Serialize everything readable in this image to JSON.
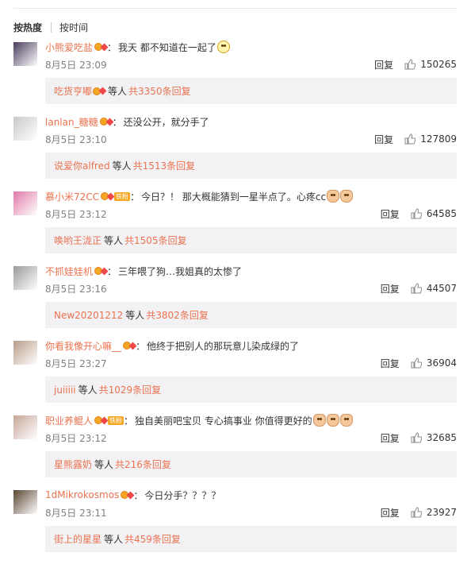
{
  "sort": {
    "hot": "按热度",
    "time": "按时间"
  },
  "comments": [
    {
      "user": "小熊爱吃盐",
      "text": "我天 都不知道在一起了",
      "emoji": [
        "wow"
      ],
      "time": "8月5日 23:09",
      "likes": "150265",
      "reply_label": "回复",
      "sub_user": "吃货亨嘟",
      "sub_mid": "等人",
      "sub_total": "共3350条回复",
      "fan_badge": false,
      "sub_badge": true,
      "avatar_color": "#4a3d5c"
    },
    {
      "user": "lanlan_糖糖",
      "text": "还没公开，就分手了",
      "emoji": [],
      "time": "8月5日 23:10",
      "likes": "127809",
      "reply_label": "回复",
      "sub_user": "说爱你alfred",
      "sub_mid": "等人",
      "sub_total": "共1513条回复",
      "fan_badge": false,
      "sub_badge": false,
      "avatar_color": "#c9c9c9"
    },
    {
      "user": "慕小米72CC",
      "text": "今日？！ 那大概能猜到一星半点了。心疼cc",
      "emoji": [
        "ok",
        "ok"
      ],
      "time": "8月5日 23:12",
      "likes": "64585",
      "reply_label": "回复",
      "sub_user": "唤哟王泷正",
      "sub_mid": "等人",
      "sub_total": "共1505条回复",
      "fan_badge": true,
      "sub_badge": false,
      "avatar_color": "#e07aa8"
    },
    {
      "user": "不抓娃娃机",
      "text": "三年喂了狗…我姐真的太惨了",
      "emoji": [],
      "time": "8月5日 23:16",
      "likes": "44507",
      "reply_label": "回复",
      "sub_user": "New20201212",
      "sub_mid": "等人",
      "sub_total": "共3802条回复",
      "fan_badge": false,
      "sub_badge": false,
      "avatar_color": "#9a9a9a"
    },
    {
      "user": "你看我像开心嘛__",
      "text": "他终于把别人的那玩意儿染成绿的了",
      "emoji": [],
      "time": "8月5日 23:27",
      "likes": "36904",
      "reply_label": "回复",
      "sub_user": "juiiiii",
      "sub_mid": "等人",
      "sub_total": "共1029条回复",
      "fan_badge": false,
      "sub_badge": false,
      "avatar_color": "#b89d8a"
    },
    {
      "user": "职业养鲲人",
      "text": "独自美丽吧宝贝 专心搞事业 你值得更好的",
      "emoji": [
        "ok",
        "ok",
        "ok"
      ],
      "time": "8月5日 23:12",
      "likes": "32685",
      "reply_label": "回复",
      "sub_user": "星熊露奶",
      "sub_mid": "等人",
      "sub_total": "共216条回复",
      "fan_badge": true,
      "sub_badge": false,
      "avatar_color": "#c7a69a"
    },
    {
      "user": "1dMikrokosmos",
      "text": "今日分手？？？？",
      "emoji": [],
      "time": "8月5日 23:11",
      "likes": "23927",
      "reply_label": "回复",
      "sub_user": "街上的星星",
      "sub_mid": "等人",
      "sub_total": "共459条回复",
      "fan_badge": false,
      "sub_badge": false,
      "avatar_color": "#5a4632"
    }
  ],
  "fan_label": "铁粉"
}
